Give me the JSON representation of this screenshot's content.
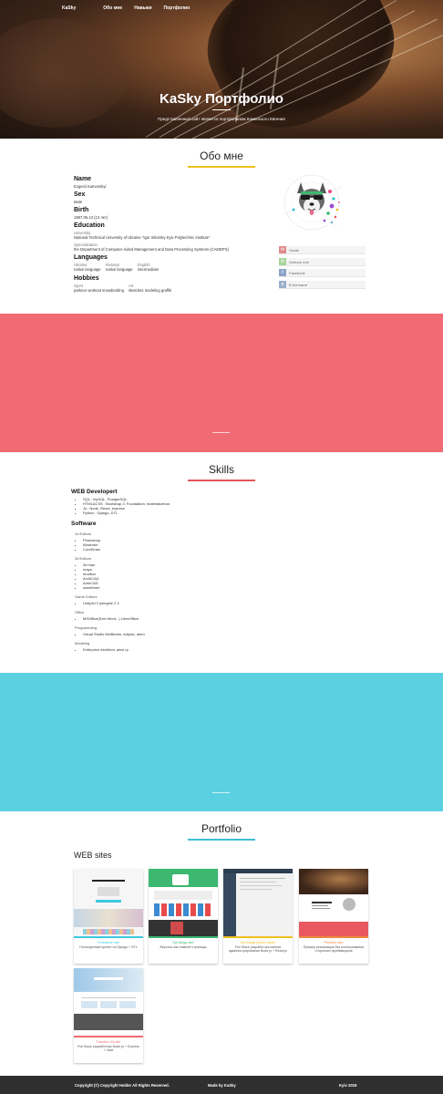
{
  "nav": {
    "brand": "KaSky",
    "items": [
      "Обо мне",
      "Навыки",
      "Портфолио"
    ]
  },
  "hero": {
    "title": "KaSky Портфолио",
    "subtitle": "Представленный сайт является портфолином Каменского Евгения"
  },
  "about": {
    "title": "Обо мне",
    "accent": "#f0c020",
    "name_label": "Name",
    "name_value": "Evgenii Kamenskyi",
    "sex_label": "Sex",
    "sex_value": "Male",
    "birth_label": "Birth",
    "birth_value": "1997.05.13 (13 лет)",
    "education_label": "Education",
    "university_label": "University",
    "university_value": "National Technical University of Ukraine \"Igor Sikorsky Kyiv Polytechnic Institute\"",
    "specialization_label": "Specialization",
    "specialization_value": "the Department of Computer-Aided Management and Data Processing Systems (CAMDPS)",
    "languages_label": "Languages",
    "languages": [
      {
        "name": "Ukraine",
        "level": "native language"
      },
      {
        "name": "Russian",
        "level": "native language"
      },
      {
        "name": "English",
        "level": "intermediate"
      }
    ],
    "hobbies_label": "Hobbies",
    "hobbies": [
      {
        "name": "Sport",
        "value": "parkour workout snowbording"
      },
      {
        "name": "Art",
        "value": "sketches modeling graffiti"
      }
    ],
    "social": [
      {
        "icon": "gmail-icon",
        "label": "Gmail",
        "color": "#e08a8a"
      },
      {
        "icon": "outlook-icon",
        "label": "Outlook Live",
        "color": "#a6d49a"
      },
      {
        "icon": "facebook-icon",
        "label": "Facebook",
        "color": "#8ea2c8"
      },
      {
        "icon": "vk-icon",
        "label": "В Контакте",
        "color": "#9ab0cc"
      }
    ]
  },
  "bands": {
    "red": "#f06b73",
    "cyan": "#5ad0e0"
  },
  "skills": {
    "title": "Skills",
    "accent": "#e8545c",
    "web_title": "WEB Developert",
    "web_items": [
      "SQL : MySQL, PostgreSQL",
      "HTML&CSS : Bootstrap 3, Foundation, materializecss",
      "Js : Node, React, express",
      "Python : Django, DTL"
    ],
    "software_title": "Software",
    "categories": [
      {
        "name": "2d Editors",
        "items": [
          "Photoshop",
          "Illustrator",
          "CorelDraw"
        ]
      },
      {
        "name": "3d Editors",
        "items": [
          "3d max",
          "maya",
          "mudbox",
          "ArchiCAD",
          "AutoCAD",
          "sweethree"
        ]
      },
      {
        "name": "Game Editors",
        "items": [
          "Unity3d Cryengine 2 3"
        ]
      },
      {
        "name": "Office",
        "items": [
          "MSOffice(Exel Word...) LibreOffice"
        ]
      },
      {
        "name": "Programming",
        "items": [
          "Visual Studio NetBeans, eclipse, atom"
        ]
      },
      {
        "name": "Modeling",
        "items": [
          "Enterprice Architect, ainsi rp"
        ]
      }
    ]
  },
  "portfolio": {
    "title": "Portfolio",
    "accent": "#3cc0d0",
    "subtitle": "WEB sites",
    "cards": [
      {
        "title": "Freelance site",
        "desc": "Полноценный проект на Django + DTL",
        "color": "#3cc8e0"
      },
      {
        "title": "Kpi Mega site",
        "desc": "Верстка как главной страницы",
        "color": "#3cb871"
      },
      {
        "title": "Kpi Mega Admin panel",
        "desc": "Full Stack разработчик панели администрирования Node.js + React.js",
        "color": "#f0c020"
      },
      {
        "title": "Portfolio site",
        "desc": "Пример реализации без использования сторонних фреймворков",
        "color": "#f08a40"
      },
      {
        "title": "Transfer UA site",
        "desc": "Full Stack разработчик Node.js + Express + Jade",
        "color": "#f06b73"
      }
    ]
  },
  "footer": {
    "copyright": "Copyright (©) Copyright Holder All Rights Reserved.",
    "made_by": "Made by KaSky",
    "place": "Kyiv 2018"
  }
}
